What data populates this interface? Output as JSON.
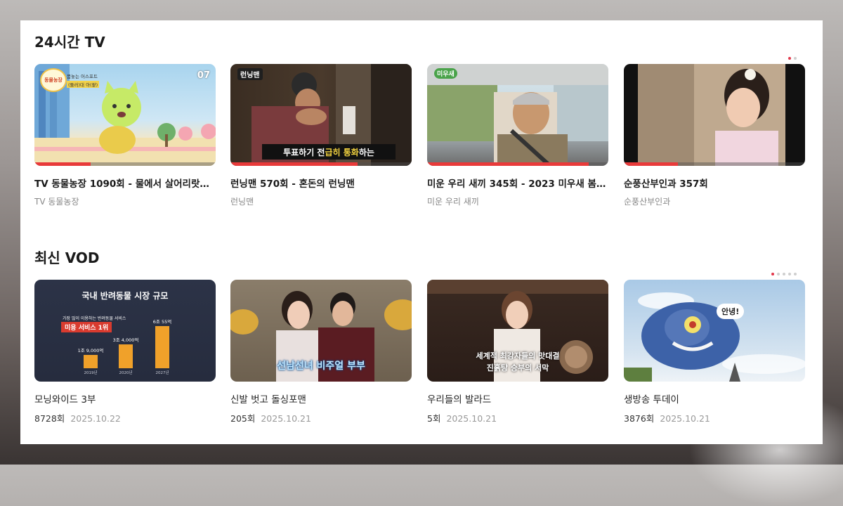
{
  "sections": [
    {
      "title": "24시간 TV",
      "pager_total": 2,
      "pager_active": 0,
      "cards": [
        {
          "title": "TV 동물농장 1090회 - 물에서 살어리랏…",
          "subtitle": "TV 동물농장",
          "progress": 0.31,
          "badge": "07",
          "logo": "동물농장",
          "caption_lines": [
            "몸놓는 어스포트",
            "(둘러)대 아(팥)"
          ]
        },
        {
          "title": "런닝맨 570회 - 혼돈의 런닝맨",
          "subtitle": "런닝맨",
          "progress": 0.7,
          "logo": "런닝맨",
          "caption_a": "투표하기 전 ",
          "caption_b": "급히 통화",
          "caption_c": "하는 "
        },
        {
          "title": "미운 우리 새끼 345회 - 2023 미우새 봄…",
          "subtitle": "미운 우리 새끼",
          "progress": 0.89,
          "logo": "미우새"
        },
        {
          "title": "순풍산부인과 357회",
          "subtitle": "순풍산부인과",
          "progress": 0.3
        }
      ]
    },
    {
      "title": "최신 VOD",
      "pager_total": 5,
      "pager_active": 0,
      "cards": [
        {
          "title": "모닝와이드 3부",
          "episodes": "8728회",
          "date": "2025.10.22",
          "thumb_text": {
            "heading": "국내 반려동물 시장 규모",
            "sub": "가장 많이 이용하는 반려동물 서비스",
            "highlight": "미용 서비스 1위",
            "bars": [
              {
                "label": "1조 9,000억",
                "year": "2019년",
                "value": 19000
              },
              {
                "label": "3조 4,000억",
                "year": "2020년",
                "value": 34000
              },
              {
                "label": "6조 55억",
                "year": "2027년",
                "value": 60055
              }
            ]
          }
        },
        {
          "title": "신발 벗고 돌싱포맨",
          "episodes": "205회",
          "date": "2025.10.21",
          "thumb_text": {
            "caption": "선남선녀 비주얼 부부"
          }
        },
        {
          "title": "우리들의 발라드",
          "episodes": "5회",
          "date": "2025.10.21",
          "thumb_text": {
            "line1": "세계적 최강자들의 맛대결",
            "line2": "진흙탕 승부의 서막"
          }
        },
        {
          "title": "생방송 투데이",
          "episodes": "3876회",
          "date": "2025.10.21",
          "thumb_text": {
            "bubble": "안녕!"
          }
        }
      ]
    }
  ],
  "colors": {
    "accent": "#e2384b",
    "progress": "#e83a3a",
    "dot_inactive": "#cfcfcf"
  }
}
